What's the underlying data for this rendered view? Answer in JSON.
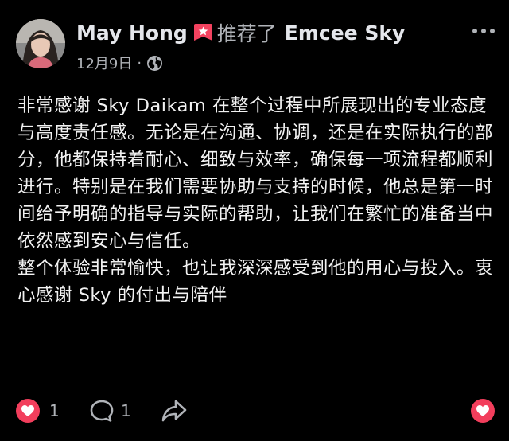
{
  "post": {
    "author": "May Hong",
    "action": "推荐了",
    "target": "Emcee Sky",
    "date": "12月9日",
    "separator": "·",
    "audience_icon": "globe-icon",
    "flag_icon": "recommend-flag-icon",
    "body": "非常感谢 Sky Daikam 在整个过程中所展现出的专业态度与高度责任感。无论是在沟通、协调，还是在实际执行的部分，他都保持着耐心、细致与效率，确保每一项流程都顺利进行。特别是在我们需要协助与支持的时候，他总是第一时间给予明确的指导与实际的帮助，让我们在繁忙的准备当中依然感到安心与信任。\n整个体验非常愉快，也让我深深感受到他的用心与投入。衷心感谢 Sky 的付出与陪伴"
  },
  "reactions": {
    "like_count": "1",
    "comment_count": "1"
  },
  "colors": {
    "background": "#000000",
    "text": "#e4e6eb",
    "muted": "#b0b3b8",
    "heart": "#f23e5c"
  }
}
